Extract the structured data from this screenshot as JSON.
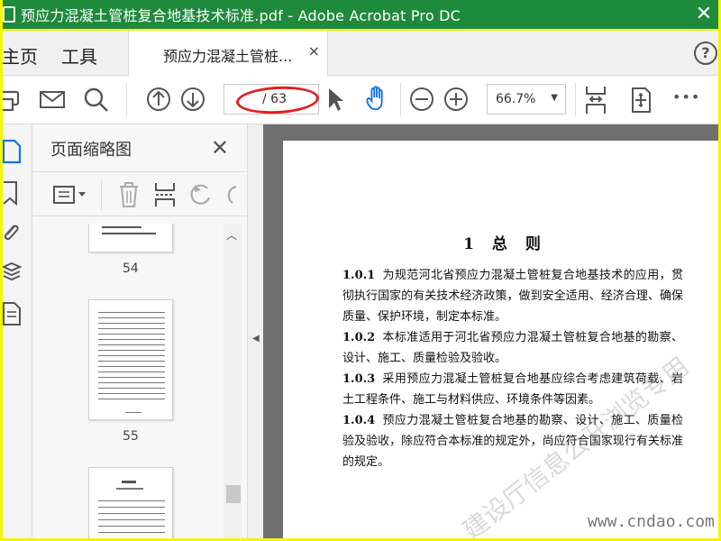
{
  "window": {
    "title": "预应力混凝土管桩复合地基技术标准.pdf - Adobe Acrobat Pro DC",
    "close_glyph": "✕"
  },
  "tabs": {
    "home_label": "主页",
    "tools_label": "工具",
    "document_label": "预应力混凝土管桩...",
    "document_close_glyph": "×",
    "help_glyph": "?"
  },
  "toolbar": {
    "current_page": "",
    "total_pages": "/ 63",
    "zoom": "66.7%",
    "zoom_caret": "▼",
    "more_glyph": "•••",
    "highlight_color": "#e02020",
    "hand_tool_color": "#1473e6"
  },
  "thumbnails": {
    "title": "页面缩略图",
    "close_glyph": "✕",
    "pages": [
      {
        "label": "54"
      },
      {
        "label": "55"
      }
    ]
  },
  "document": {
    "heading": "1 总 则",
    "clauses": [
      {
        "num": "1.0.1",
        "text": "为规范河北省预应力混凝土管桩复合地基技术的应用，贯彻执行国家的有关技术经济政策，做到安全适用、经济合理、确保质量、保护环境，制定本标准。"
      },
      {
        "num": "1.0.2",
        "text": "本标准适用于河北省预应力混凝土管桩复合地基的勘察、设计、施工、质量检验及验收。"
      },
      {
        "num": "1.0.3",
        "text": "采用预应力混凝土管桩复合地基应综合考虑建筑荷载、岩土工程条件、施工与材料供应、环境条件等因素。"
      },
      {
        "num": "1.0.4",
        "text": "预应力混凝土管桩复合地基的勘察、设计、施工、质量检验及验收，除应符合本标准的规定外，尚应符合国家现行有关标准的规定。"
      }
    ],
    "watermark": "建设厅信息公开浏览专用"
  },
  "site_watermark": "www.cndao.com",
  "colors": {
    "titlebar": "#1e8a3c",
    "frame": "#f5f500",
    "doc_background": "#707070"
  }
}
